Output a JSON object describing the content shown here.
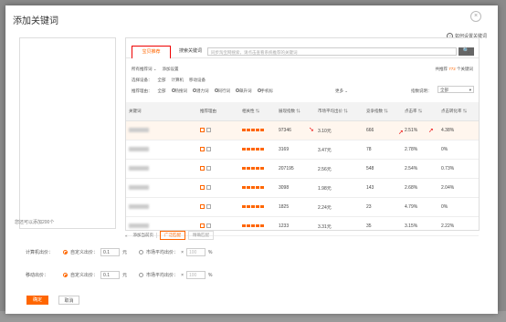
{
  "modal": {
    "title": "添加关键词",
    "close_icon": "×",
    "howto_label": "如何设置关键词"
  },
  "left_panel": {
    "footer": "您还可以添加200个"
  },
  "tabs": {
    "active": "宝贝推荐",
    "search_label": "搜索关键词",
    "search_placeholder": "同步淘宝网搜索，请点击查看系统推荐的关键词",
    "search_icon": "🔍"
  },
  "filters": {
    "row1": {
      "all": "所有推荐词",
      "arrow": "⌄",
      "settings": "添加设置"
    },
    "row2": {
      "label": "选择设备：",
      "options": [
        "全部",
        "计算机",
        "移动设备"
      ]
    },
    "row3": {
      "label": "推荐理由：",
      "options": [
        "全部",
        "热搜词",
        "潜力词",
        "同行词",
        "飙升词",
        "手机标"
      ],
      "more": "更多"
    },
    "count_prefix": "共推荐",
    "count_value": "772",
    "count_suffix": "个关键词",
    "sort_label": "指数说明：",
    "sort_value": "全部"
  },
  "table": {
    "headers": [
      "关键词",
      "推荐理由",
      "相关性",
      "展现指数",
      "市场平均出价",
      "竞争指数",
      "点击率",
      "点击转化率"
    ],
    "rows": [
      {
        "impressions": "97346",
        "avg_bid": "3.10元",
        "competition": "666",
        "ctr": "2.51%",
        "cvr": "4.38%"
      },
      {
        "impressions": "3169",
        "avg_bid": "3.47元",
        "competition": "78",
        "ctr": "2.78%",
        "cvr": "0%"
      },
      {
        "impressions": "207195",
        "avg_bid": "2.56元",
        "competition": "548",
        "ctr": "2.54%",
        "cvr": "0.73%"
      },
      {
        "impressions": "3098",
        "avg_bid": "1.98元",
        "competition": "143",
        "ctr": "2.68%",
        "cvr": "2.04%"
      },
      {
        "impressions": "1825",
        "avg_bid": "2.24元",
        "competition": "23",
        "ctr": "4.79%",
        "cvr": "0%"
      },
      {
        "impressions": "1233",
        "avg_bid": "3.31元",
        "competition": "35",
        "ctr": "3.15%",
        "cvr": "2.22%"
      }
    ]
  },
  "pager": {
    "add": "添加当前页",
    "active": "广泛匹配",
    "other": "精确匹配"
  },
  "bids": {
    "pc": {
      "label": "计算机出价：",
      "custom": "自定义出价：",
      "value": "0.1",
      "unit": "元",
      "market": "市场平均出价：",
      "pct": "100",
      "pct_unit": "%"
    },
    "mobile": {
      "label": "移动出价：",
      "custom": "自定义出价：",
      "value": "0.1",
      "unit": "元",
      "market": "市场平均出价：",
      "pct": "100",
      "pct_unit": "%"
    }
  },
  "buttons": {
    "ok": "确定",
    "cancel": "取消"
  },
  "colors": {
    "accent": "#ff6600",
    "annotation": "#ee0000"
  }
}
